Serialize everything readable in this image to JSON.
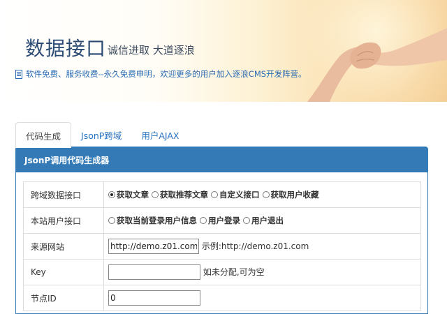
{
  "banner": {
    "title": "数据接口",
    "slogan": "诚信进取 大道逐浪",
    "notice": "软件免费、服务收费--永久免费申明，欢迎更多的用户加入逐浪CMS开发阵营。"
  },
  "tabs": [
    {
      "label": "代码生成",
      "active": true
    },
    {
      "label": "JsonP跨域",
      "active": false
    },
    {
      "label": "用户AJAX",
      "active": false
    }
  ],
  "panel": {
    "title": "JsonP调用代码生成器"
  },
  "form": {
    "cross_domain": {
      "label": "跨域数据接口",
      "options": [
        "获取文章",
        "获取推荐文章",
        "自定义接口",
        "获取用户收藏"
      ],
      "selected": "获取文章"
    },
    "local_user": {
      "label": "本站用户接口",
      "options": [
        "获取当前登录用户信息",
        "用户登录",
        "用户退出"
      ]
    },
    "source_site": {
      "label": "来源网站",
      "value": "http://demo.z01.com/",
      "hint": "示例:http://demo.z01.com"
    },
    "key": {
      "label": "Key",
      "value": "",
      "hint": "如未分配,可为空"
    },
    "node_id": {
      "label": "节点ID",
      "value": "0"
    }
  },
  "colors": {
    "panel_header": "#337ab7",
    "link": "#2a73c0",
    "title": "#2b4a74"
  }
}
